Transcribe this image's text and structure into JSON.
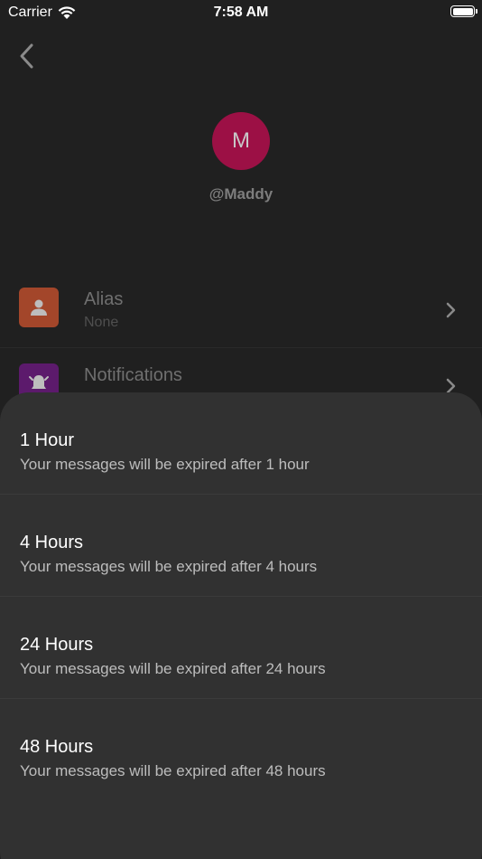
{
  "status_bar": {
    "carrier": "Carrier",
    "time": "7:58 AM"
  },
  "profile": {
    "avatar_initial": "M",
    "username": "@Maddy",
    "avatar_color": "#9c1045"
  },
  "settings": {
    "alias": {
      "title": "Alias",
      "value": "None"
    },
    "notifications": {
      "title": "Notifications"
    }
  },
  "sheet": {
    "options": [
      {
        "title": "1 Hour",
        "description": "Your messages will be expired after 1 hour"
      },
      {
        "title": "4 Hours",
        "description": "Your messages will be expired after 4 hours"
      },
      {
        "title": "24 Hours",
        "description": "Your messages will be expired after 24 hours"
      },
      {
        "title": "48 Hours",
        "description": "Your messages will be expired after 48 hours"
      }
    ]
  },
  "icons": {
    "back": "chevron-left-icon",
    "wifi": "wifi-icon",
    "battery": "battery-icon",
    "alias": "person-icon",
    "notifications": "bell-icon",
    "row_chevron": "chevron-right-icon"
  }
}
